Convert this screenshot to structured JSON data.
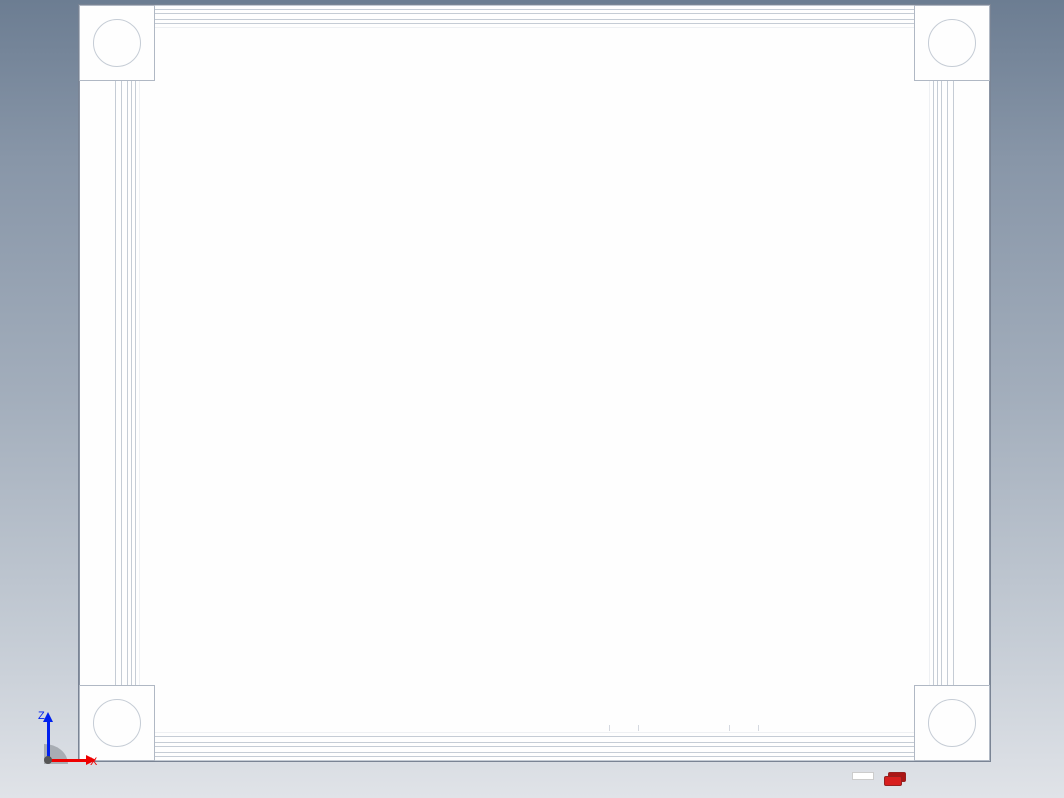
{
  "viewport": {
    "coordinate_system": {
      "vertical_axis_label": "Z",
      "horizontal_axis_label": "X",
      "vertical_axis_color": "#0020ee",
      "horizontal_axis_color": "#ee0000"
    }
  }
}
